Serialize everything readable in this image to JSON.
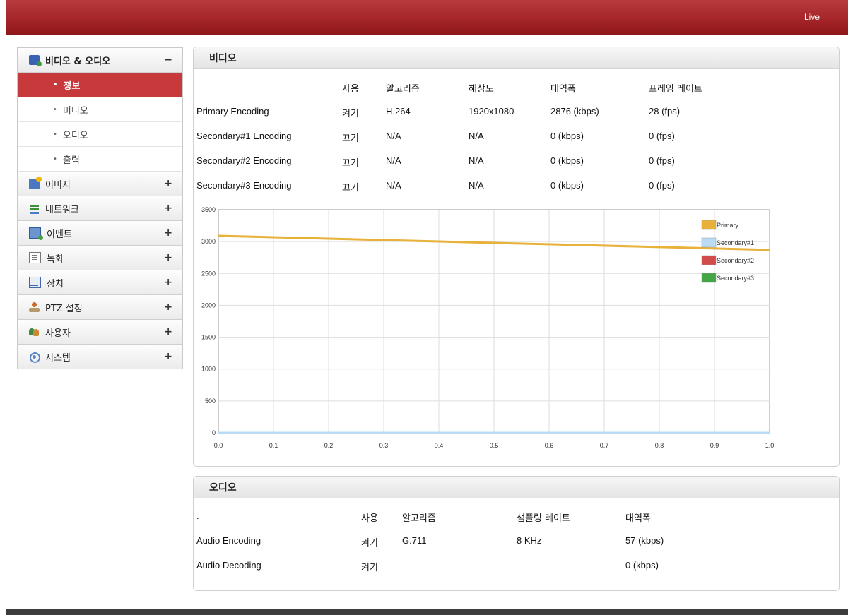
{
  "topbar": {
    "live_label": "Live"
  },
  "sidebar": {
    "items": [
      {
        "label": "비디오 & 오디오",
        "sign": "−",
        "icon": "video-audio-icon"
      },
      {
        "label": "이미지",
        "sign": "+",
        "icon": "image-icon"
      },
      {
        "label": "네트워크",
        "sign": "+",
        "icon": "network-icon"
      },
      {
        "label": "이벤트",
        "sign": "+",
        "icon": "event-icon"
      },
      {
        "label": "녹화",
        "sign": "+",
        "icon": "record-icon"
      },
      {
        "label": "장치",
        "sign": "+",
        "icon": "device-icon"
      },
      {
        "label": "PTZ 설정",
        "sign": "+",
        "icon": "ptz-icon"
      },
      {
        "label": "사용자",
        "sign": "+",
        "icon": "user-icon"
      },
      {
        "label": "시스템",
        "sign": "+",
        "icon": "system-icon"
      }
    ],
    "subitems": [
      {
        "label": "정보",
        "bullet": "•"
      },
      {
        "label": "비디오",
        "bullet": "•"
      },
      {
        "label": "오디오",
        "bullet": "•"
      },
      {
        "label": "출력",
        "bullet": "•"
      }
    ],
    "active_subitem": "정보"
  },
  "video": {
    "title": "비디오",
    "headers": [
      "사용",
      "알고리즘",
      "해상도",
      "대역폭",
      "프레임 레이트"
    ],
    "rows": [
      {
        "name": "Primary Encoding",
        "use": "켜기",
        "algo": "H.264",
        "res": "1920x1080",
        "bw": "2876 (kbps)",
        "fps": "28 (fps)"
      },
      {
        "name": "Secondary#1 Encoding",
        "use": "끄기",
        "algo": "N/A",
        "res": "N/A",
        "bw": "0 (kbps)",
        "fps": "0 (fps)"
      },
      {
        "name": "Secondary#2 Encoding",
        "use": "끄기",
        "algo": "N/A",
        "res": "N/A",
        "bw": "0 (kbps)",
        "fps": "0 (fps)"
      },
      {
        "name": "Secondary#3 Encoding",
        "use": "끄기",
        "algo": "N/A",
        "res": "N/A",
        "bw": "0 (kbps)",
        "fps": "0 (fps)"
      }
    ]
  },
  "chart_data": {
    "type": "line",
    "x": [
      0.0,
      1.0
    ],
    "xticks": [
      "0.0",
      "0.1",
      "0.2",
      "0.3",
      "0.4",
      "0.5",
      "0.6",
      "0.7",
      "0.8",
      "0.9",
      "1.0"
    ],
    "yticks": [
      "0",
      "500",
      "1000",
      "1500",
      "2000",
      "2500",
      "3000",
      "3500"
    ],
    "xlim": [
      0.0,
      1.0
    ],
    "ylim": [
      0,
      3500
    ],
    "grid": true,
    "legend": "top-right",
    "series": [
      {
        "name": "Primary",
        "color": "#e8b13a",
        "values": [
          3090,
          2870
        ]
      },
      {
        "name": "Secondary#1",
        "color": "#b9dcf4",
        "values": [
          0,
          0
        ]
      },
      {
        "name": "Secondary#2",
        "color": "#d24b4b",
        "values": [
          0,
          0
        ]
      },
      {
        "name": "Secondary#3",
        "color": "#45a545",
        "values": [
          0,
          0
        ]
      }
    ]
  },
  "audio": {
    "title": "오디오",
    "header_first": ".",
    "headers": [
      "사용",
      "알고리즘",
      "샘플링 레이트",
      "대역폭"
    ],
    "rows": [
      {
        "name": "Audio Encoding",
        "use": "켜기",
        "algo": "G.711",
        "rate": "8 KHz",
        "bw": "57 (kbps)"
      },
      {
        "name": "Audio Decoding",
        "use": "켜기",
        "algo": "-",
        "rate": "-",
        "bw": "0 (kbps)"
      }
    ]
  }
}
